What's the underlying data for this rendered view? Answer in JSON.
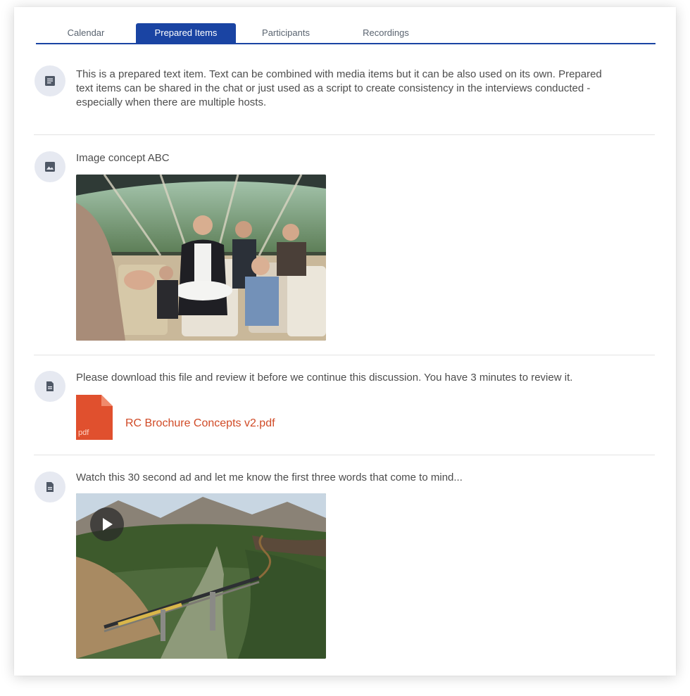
{
  "tabs": [
    {
      "label": "Calendar",
      "active": false
    },
    {
      "label": "Prepared Items",
      "active": true
    },
    {
      "label": "Participants",
      "active": false
    },
    {
      "label": "Recordings",
      "active": false
    }
  ],
  "accent_color": "#1a44a3",
  "items": [
    {
      "type": "text",
      "icon": "text-document-icon",
      "text": "This is a prepared text item. Text can be combined with media items but it can be also used on its own. Prepared text items can be shared in the chat or just used as a script to create consistency in the interviews conducted - especially when there are multiple hosts."
    },
    {
      "type": "image",
      "icon": "image-icon",
      "text": "Image concept ABC"
    },
    {
      "type": "file",
      "icon": "file-icon",
      "text": "Please download this file and review it before we continue this discussion. You have 3 minutes to review it.",
      "file_type": "pdf",
      "file_name": "RC Brochure Concepts v2.pdf",
      "file_color": "#e0502e"
    },
    {
      "type": "video",
      "icon": "file-icon",
      "text": "Watch this 30 second ad and let me know the first three words that come to mind..."
    }
  ]
}
